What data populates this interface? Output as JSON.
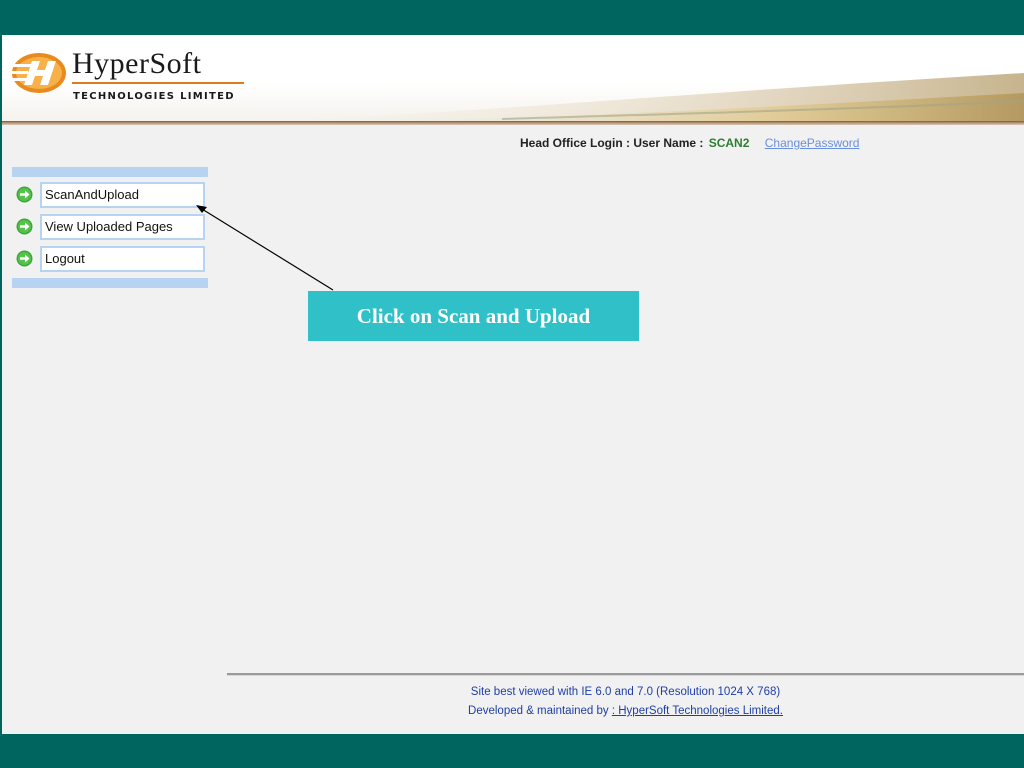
{
  "header": {
    "logo_name": "HyperSoft",
    "logo_sub": "TECHNOLOGIES LIMITED"
  },
  "login": {
    "prefix": "Head Office Login : User Name :",
    "user_name": "SCAN2",
    "change_password": "ChangePassword"
  },
  "menu": {
    "items": [
      {
        "label": "ScanAndUpload",
        "icon": "green-arrow-icon"
      },
      {
        "label": "View Uploaded Pages",
        "icon": "green-arrow-icon"
      },
      {
        "label": "Logout",
        "icon": "green-arrow-icon"
      }
    ]
  },
  "callout": {
    "text": "Click on Scan and Upload"
  },
  "footer": {
    "line1": "Site best viewed with IE 6.0 and 7.0 (Resolution 1024 X 768)",
    "line2_prefix": "Developed & maintained by ",
    "line2_link": ": HyperSoft Technologies Limited."
  },
  "colors": {
    "frame": "#00655f",
    "callout_bg": "#2fc0c8",
    "menu_border": "#b7d3f2",
    "user_name": "#2e7d32",
    "link": "#6a8fdc",
    "footer_text": "#1f3fa6"
  }
}
